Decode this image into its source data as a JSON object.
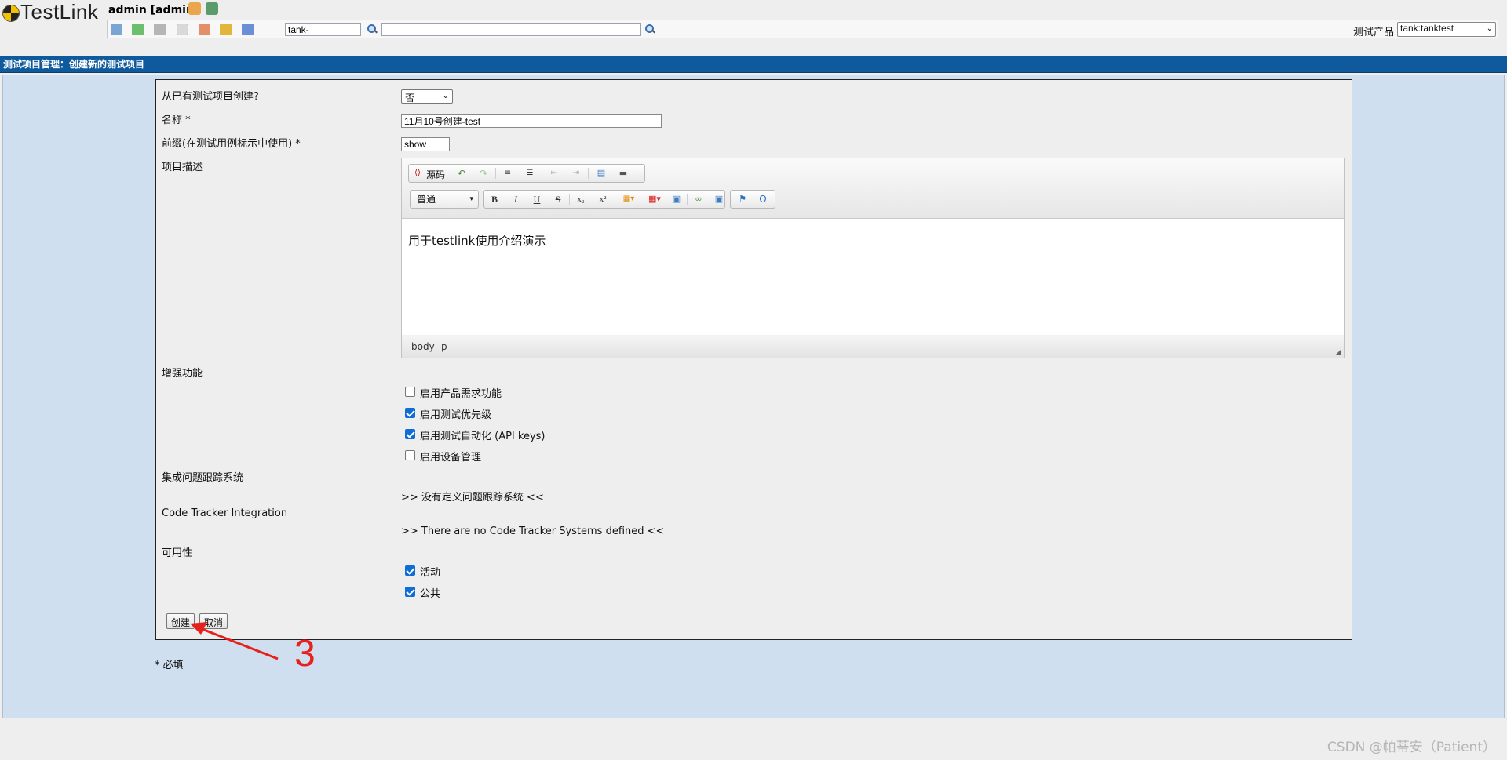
{
  "app": {
    "logo_text": "TestLink"
  },
  "header": {
    "user": "admin [admin]",
    "search_value": "tank-",
    "search2_value": "",
    "product_label": "测试产品",
    "product_value": "tank:tanktest"
  },
  "title_bar": "测试项目管理：创建新的测试项目",
  "form": {
    "from_existing_label": "从已有测试项目创建?",
    "from_existing_value": "否",
    "name_label": "名称 *",
    "name_value": "11月10号创建-test",
    "prefix_label": "前缀(在测试用例标示中使用) *",
    "prefix_value": "show",
    "desc_label": "项目描述",
    "editor": {
      "source_btn": "源码",
      "format_value": "普通",
      "content": "用于testlink使用介绍演示",
      "status_items": [
        "body",
        "p"
      ]
    },
    "enhance_label": "增强功能",
    "features": [
      {
        "label": "启用产品需求功能",
        "checked": false
      },
      {
        "label": "启用测试优先级",
        "checked": true
      },
      {
        "label": "启用测试自动化 (API keys)",
        "checked": true
      },
      {
        "label": "启用设备管理",
        "checked": false
      }
    ],
    "issue_tracker_label": "集成问题跟踪系统",
    "issue_tracker_info": ">> 没有定义问题跟踪系统 <<",
    "code_tracker_label": "Code Tracker Integration",
    "code_tracker_info": ">> There are no Code Tracker Systems defined <<",
    "availability_label": "可用性",
    "availability": [
      {
        "label": "活动",
        "checked": true
      },
      {
        "label": "公共",
        "checked": true
      }
    ],
    "create_btn": "创建",
    "cancel_btn": "取消"
  },
  "required_note": "* 必填",
  "annotation_number": "3",
  "watermark": "CSDN @帕蒂安（Patient）",
  "colors": {
    "title_bar": "#0e5a9c",
    "workspace": "#cfdff0",
    "annotation": "#e8201c",
    "checkbox": "#0f6dd6"
  }
}
